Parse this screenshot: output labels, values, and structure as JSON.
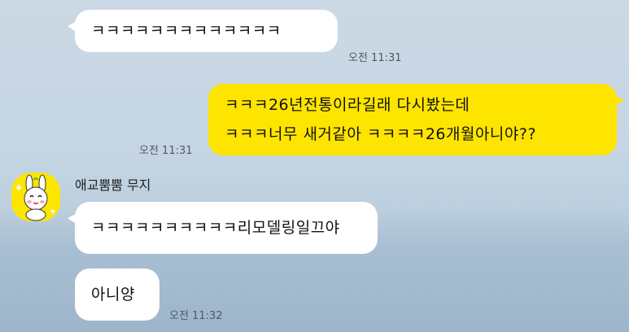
{
  "messages": [
    {
      "id": "m1",
      "side": "left",
      "text": "ㅋㅋㅋㅋㅋㅋㅋㅋㅋㅋㅋㅋㅋ",
      "time": "오전 11:31"
    },
    {
      "id": "m2",
      "side": "right",
      "lines": [
        "ㅋㅋㅋ26년전통이라길래 다시봤는데",
        "ㅋㅋㅋ너무 새거같아 ㅋㅋㅋㅋ26개월아니야??"
      ],
      "time": "오전 11:31"
    },
    {
      "id": "m3",
      "side": "left",
      "sender": "애교뿜뿜 무지",
      "text": "ㅋㅋㅋㅋㅋㅋㅋㅋㅋㅋ리모델링일끄야"
    },
    {
      "id": "m4",
      "side": "left",
      "text": "아니양",
      "time": "오전 11:32"
    }
  ],
  "colors": {
    "my_bubble": "#fee500",
    "their_bubble": "#ffffff",
    "avatar_bg": "#fee500"
  },
  "avatar_icon": "muzi-character-icon"
}
